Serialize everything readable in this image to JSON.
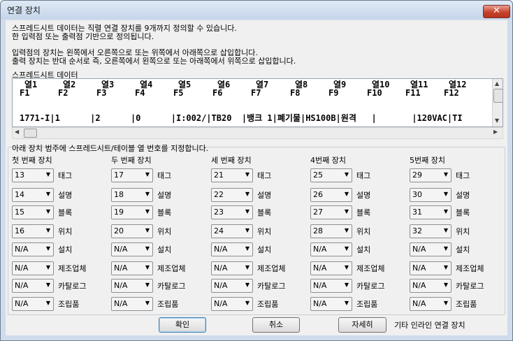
{
  "window": {
    "title": "연결 장치",
    "close_label": "✕"
  },
  "intro": [
    "스프레드시트 데이터는 직렬 연결 장치를 9개까지 정의할 수 있습니다.",
    "한 입력점 또는 출력점 기반으로 정의됩니다.",
    "입력점의 장치는 왼쪽에서 오른쪽으로 또는 위쪽에서 아래쪽으로 삽입합니다.",
    "출력 장치는 반대 순서로 즉, 오른쪽에서 왼쪽으로 또는 아래쪽에서 위쪽으로 삽입합니다."
  ],
  "grid": {
    "label": "스프레드시트 데이터",
    "columns": [
      {
        "header": "열1",
        "field": "F1"
      },
      {
        "header": "열2",
        "field": "F2"
      },
      {
        "header": "열3",
        "field": "F3"
      },
      {
        "header": "열4",
        "field": "F4"
      },
      {
        "header": "열5",
        "field": "F5"
      },
      {
        "header": "열6",
        "field": "F6"
      },
      {
        "header": "열7",
        "field": "F7"
      },
      {
        "header": "열8",
        "field": "F8"
      },
      {
        "header": "열9",
        "field": "F9"
      },
      {
        "header": "열10",
        "field": "F10"
      },
      {
        "header": "열11",
        "field": "F11"
      },
      {
        "header": "열12",
        "field": "F12"
      }
    ],
    "data_row": "1771-I|1      |2      |0      |I:002/|TB20  |뱅크 1|폐기물|HS100B|원격   |       |120VAC|TI"
  },
  "section_label": "아래 장치 범주에 스프레드시트/테이블 열 번호를 지정합니다.",
  "devices": [
    {
      "heading": "첫 번째 장치",
      "values": [
        "13",
        "14",
        "15",
        "16",
        "N/A",
        "N/A",
        "N/A",
        "N/A"
      ]
    },
    {
      "heading": "두 번째 장치",
      "values": [
        "17",
        "18",
        "19",
        "20",
        "N/A",
        "N/A",
        "N/A",
        "N/A"
      ]
    },
    {
      "heading": "세 번째 장치",
      "values": [
        "21",
        "22",
        "23",
        "24",
        "N/A",
        "N/A",
        "N/A",
        "N/A"
      ]
    },
    {
      "heading": "4번째 장치",
      "values": [
        "25",
        "26",
        "27",
        "28",
        "N/A",
        "N/A",
        "N/A",
        "N/A"
      ]
    },
    {
      "heading": "5번째 장치",
      "values": [
        "29",
        "30",
        "31",
        "32",
        "N/A",
        "N/A",
        "N/A",
        "N/A"
      ]
    }
  ],
  "field_labels": [
    "태그",
    "설명",
    "블록",
    "위치",
    "설치",
    "제조업체",
    "카탈로그",
    "조립품"
  ],
  "buttons": {
    "ok": "확인",
    "cancel": "취소",
    "details": "자세히"
  },
  "other_label": "기타 인라인 연결 장치"
}
